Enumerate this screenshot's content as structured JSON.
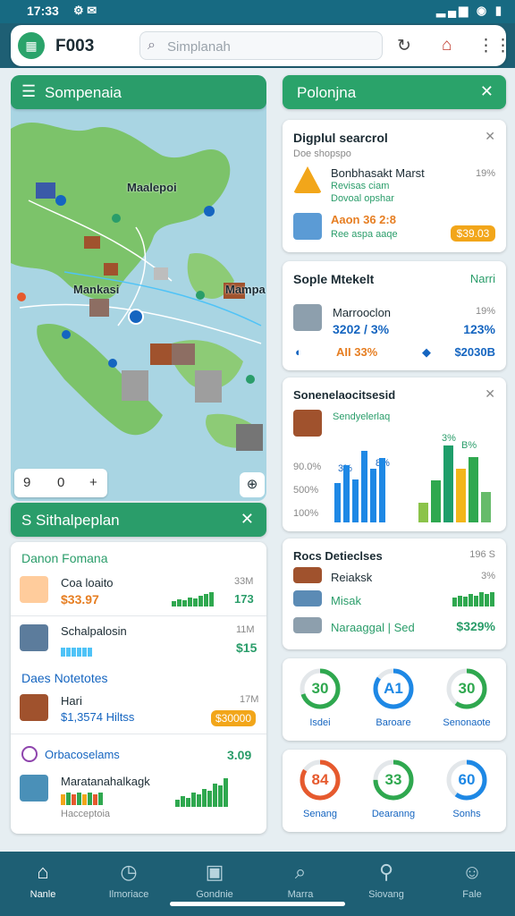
{
  "status_bar": {
    "time": "17:33"
  },
  "app": {
    "title": "F003",
    "search_placeholder": "Simplanah"
  },
  "map_panel": {
    "title": "Sompenaia",
    "labels": [
      "Maalepoi",
      "Mankasi",
      "Mampa"
    ],
    "controls": [
      "9",
      "0",
      "+"
    ]
  },
  "list_panel": {
    "title": "S Sithalpeplan",
    "sections": [
      {
        "heading": "Danon Fomana",
        "items": [
          {
            "name": "Coa loaito",
            "value": "$33.97",
            "meta": "33M",
            "figure": "173"
          },
          {
            "name": "Schalpalosin",
            "meta": "11M",
            "figure": "$15"
          }
        ]
      },
      {
        "heading": "Daes Notetotes",
        "items": [
          {
            "name": "Hari",
            "value": "$1,3574 Hiltss",
            "meta": "17M",
            "badge": "$30000"
          }
        ]
      },
      {
        "heading": "Orbacoselams",
        "figure": "3.09",
        "items": [
          {
            "name": "Maratanahalkagk",
            "meta": "Hacceptoia"
          }
        ]
      }
    ]
  },
  "right_panel": {
    "title": "Polonjna",
    "card1": {
      "title": "Digplul searcrol",
      "subtitle": "Doe shopspo",
      "item1": {
        "name": "Bonbhasakt Marst",
        "sub": "Revisas ciam",
        "sub2": "Dovoal opshar",
        "pct": "19%"
      },
      "item2": {
        "name": "Aaon 36 2:8",
        "sub": "Ree aspa aaqe",
        "badge": "$39.03"
      }
    },
    "card2": {
      "title": "Sople Mtekelt",
      "action": "Narri",
      "name": "Marrooclon",
      "value": "3202 / 3%",
      "pct1": "19%",
      "pct2": "123%",
      "stat1": "AII 33%",
      "stat2": "$2030B"
    },
    "card3": {
      "title": "Sonenelaocitsesid",
      "subtitle": "Sendyelerlaq",
      "y_ticks": [
        "90.0%",
        "500%",
        "100%"
      ],
      "bar_labels": [
        "3%",
        "8%"
      ],
      "top_labels": [
        "3%",
        "B%"
      ],
      "left_bars": [
        0.55,
        0.8,
        0.6,
        1.0,
        0.75,
        0.9
      ],
      "right_bars": [
        0.25,
        0.55,
        1.0,
        0.7,
        0.85,
        0.4
      ]
    },
    "card4": {
      "title": "Rocs Detieclses",
      "meta": "196 S",
      "rows": [
        {
          "name": "Reiaksk",
          "meta": "3%"
        },
        {
          "name": "Misak"
        },
        {
          "name": "Naraaggal | Sed",
          "value": "$329%"
        }
      ]
    },
    "rings1": [
      {
        "value": "30",
        "label": "Isdei",
        "color": "#2fa84f",
        "progress": 0.7
      },
      {
        "value": "A1",
        "label": "Baroare",
        "color": "#1e88e5",
        "progress": 0.85
      },
      {
        "value": "30",
        "label": "Senonaote",
        "color": "#2fa84f",
        "progress": 0.6
      }
    ],
    "rings2": [
      {
        "value": "84",
        "label": "Senang",
        "color": "#e65a2e",
        "progress": 0.84
      },
      {
        "value": "33",
        "label": "Dearanng",
        "color": "#2fa84f",
        "progress": 0.75
      },
      {
        "value": "60",
        "label": "Sonhs",
        "color": "#1e88e5",
        "progress": 0.6
      }
    ]
  },
  "nav": [
    {
      "label": "Nanle",
      "icon": "home-icon"
    },
    {
      "label": "Ilmoriace",
      "icon": "clock-icon"
    },
    {
      "label": "Gondnie",
      "icon": "chart-icon"
    },
    {
      "label": "Marra",
      "icon": "search-icon"
    },
    {
      "label": "Siovang",
      "icon": "profile-icon"
    },
    {
      "label": "Fale",
      "icon": "user-icon"
    }
  ]
}
